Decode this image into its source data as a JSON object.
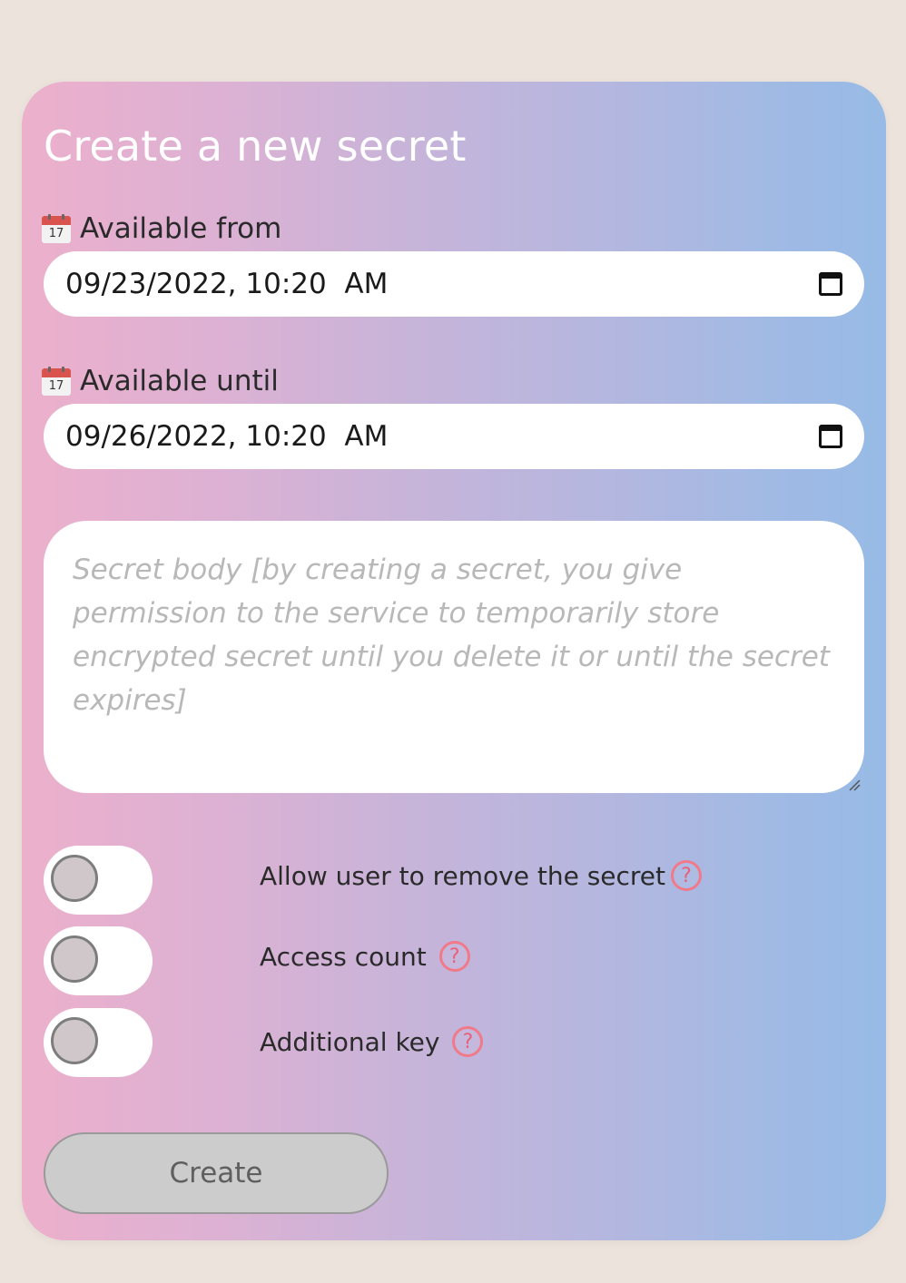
{
  "form": {
    "title": "Create a new secret",
    "available_from": {
      "icon": "calendar-icon",
      "icon_day": "17",
      "label": "Available from",
      "value": "09/23/2022, 10:20  AM"
    },
    "available_until": {
      "icon": "calendar-icon",
      "icon_day": "17",
      "label": "Available until",
      "value": "09/26/2022, 10:20  AM"
    },
    "secret_body": {
      "placeholder": "Secret body [by creating a secret, you give permission to the service to temporarily store encrypted secret until you delete it or until the secret expires]",
      "value": ""
    },
    "options": [
      {
        "label": "Allow user to remove the secret",
        "enabled": false,
        "help": "?"
      },
      {
        "label": "Access count",
        "enabled": false,
        "help": "?"
      },
      {
        "label": "Additional key",
        "enabled": false,
        "help": "?"
      }
    ],
    "create_label": "Create"
  },
  "colors": {
    "gradient_start": "#ecb0cb",
    "gradient_end": "#97bbe6",
    "page_background": "#ece4dc",
    "help_accent": "#f07a8a",
    "button_disabled": "#cccccc"
  }
}
